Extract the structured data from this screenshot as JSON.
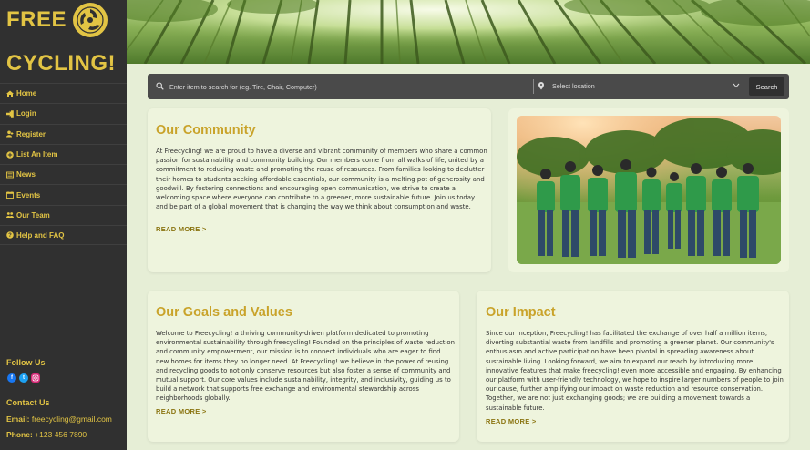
{
  "brand": {
    "line1": "FREE",
    "line2": "CYCLING!"
  },
  "nav": {
    "items": [
      {
        "label": "Home",
        "icon": "home-icon"
      },
      {
        "label": "Login",
        "icon": "login-icon"
      },
      {
        "label": "Register",
        "icon": "register-icon"
      },
      {
        "label": "List An Item",
        "icon": "plus-circle-icon"
      },
      {
        "label": "News",
        "icon": "newspaper-icon"
      },
      {
        "label": "Events",
        "icon": "calendar-icon"
      },
      {
        "label": "Our Team",
        "icon": "users-icon"
      },
      {
        "label": "Help and FAQ",
        "icon": "question-icon"
      }
    ]
  },
  "follow": {
    "title": "Follow Us",
    "networks": [
      "facebook",
      "twitter",
      "instagram"
    ]
  },
  "contact": {
    "title": "Contact Us",
    "email_label": "Email:",
    "email_value": "freecycling@gmail.com",
    "phone_label": "Phone:",
    "phone_value": "+123 456 7890"
  },
  "search": {
    "placeholder": "Enter item to search for (eg. Tire, Chair, Computer)",
    "location_placeholder": "Select location",
    "button_label": "Search"
  },
  "community": {
    "title": "Our Community",
    "text": "At Freecycling! we are proud to have a diverse and vibrant community of members who share a common passion for sustainability and community building. Our members come from all walks of life, united by a commitment to reducing waste and promoting the reuse of resources. From families looking to declutter their homes to students seeking affordable essentials, our community is a melting pot of generosity and goodwill. By fostering connections and encouraging open communication, we strive to create a welcoming space where everyone can contribute to a greener, more sustainable future. Join us today and be part of a global movement that is changing the way we think about consumption and waste.",
    "read_more": "READ MORE >"
  },
  "goals": {
    "title": "Our Goals and Values",
    "text": "Welcome to Freecycling! a thriving community-driven platform dedicated to promoting environmental sustainability through freecycling! Founded on the principles of waste reduction and community empowerment, our mission is to connect individuals who are eager to find new homes for items they no longer need. At Freecycling! we believe in the power of reusing and recycling goods to not only conserve resources but also foster a sense of community and mutual support. Our core values include sustainability, integrity, and inclusivity, guiding us to build a network that supports free exchange and environmental stewardship across neighborhoods globally.",
    "read_more": "READ MORE >"
  },
  "impact": {
    "title": "Our Impact",
    "text": "Since our inception, Freecycling! has facilitated the exchange of over half a million items, diverting substantial waste from landfills and promoting a greener planet. Our community's enthusiasm and active participation have been pivotal in spreading awareness about sustainable living. Looking forward, we aim to expand our reach by introducing more innovative features that make freecycling! even more accessible and engaging. By enhancing our platform with user-friendly technology, we hope to inspire larger numbers of people to join our cause, further amplifying our impact on waste reduction and resource conservation. Together, we are not just exchanging goods; we are building a movement towards a sustainable future.",
    "read_more": "READ MORE >"
  },
  "colors": {
    "accent": "#e2c444",
    "sidebar": "#303030",
    "heading": "#c9a32a",
    "background": "#e6eed6"
  }
}
